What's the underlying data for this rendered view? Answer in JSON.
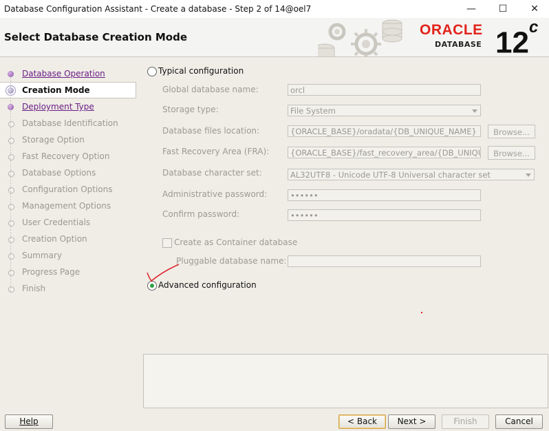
{
  "window": {
    "title": "Database Configuration Assistant - Create a database - Step 2 of 14@oel7",
    "minimize": "—",
    "maximize": "☐",
    "close": "✕"
  },
  "header": {
    "title": "Select Database Creation Mode",
    "brand": "ORACLE",
    "brand_sub": "DATABASE",
    "version": "12",
    "version_suffix": "c"
  },
  "steps": [
    {
      "label": "Database Operation",
      "state": "done"
    },
    {
      "label": "Creation Mode",
      "state": "current"
    },
    {
      "label": "Deployment Type",
      "state": "done"
    },
    {
      "label": "Database Identification",
      "state": "todo"
    },
    {
      "label": "Storage Option",
      "state": "todo"
    },
    {
      "label": "Fast Recovery Option",
      "state": "todo"
    },
    {
      "label": "Database Options",
      "state": "todo"
    },
    {
      "label": "Configuration Options",
      "state": "todo"
    },
    {
      "label": "Management Options",
      "state": "todo"
    },
    {
      "label": "User Credentials",
      "state": "todo"
    },
    {
      "label": "Creation Option",
      "state": "todo"
    },
    {
      "label": "Summary",
      "state": "todo"
    },
    {
      "label": "Progress Page",
      "state": "todo"
    },
    {
      "label": "Finish",
      "state": "todo"
    }
  ],
  "typical": {
    "radio_label": "Typical configuration",
    "selected": false,
    "global_db_name_label": "Global database name:",
    "global_db_name_value": "orcl",
    "storage_type_label": "Storage type:",
    "storage_type_value": "File System",
    "db_files_location_label": "Database files location:",
    "db_files_location_value": "{ORACLE_BASE}/oradata/{DB_UNIQUE_NAME}",
    "fra_label": "Fast Recovery Area (FRA):",
    "fra_value": "{ORACLE_BASE}/fast_recovery_area/{DB_UNIQU",
    "browse_label": "Browse...",
    "charset_label": "Database character set:",
    "charset_value": "AL32UTF8 - Unicode UTF-8 Universal character set",
    "admin_pw_label": "Administrative password:",
    "admin_pw_value": "••••••",
    "confirm_pw_label": "Confirm password:",
    "confirm_pw_value": "••••••",
    "container_label": "Create as Container database",
    "pluggable_label": "Pluggable database name:",
    "pluggable_value": ""
  },
  "advanced": {
    "radio_label": "Advanced configuration",
    "selected": true
  },
  "buttons": {
    "help": "Help",
    "back": "< Back",
    "next": "Next >",
    "finish": "Finish",
    "cancel": "Cancel"
  },
  "colors": {
    "oracle_red": "#e2231a",
    "done_step": "#6b1d86",
    "annotation_red": "#e0202a"
  }
}
